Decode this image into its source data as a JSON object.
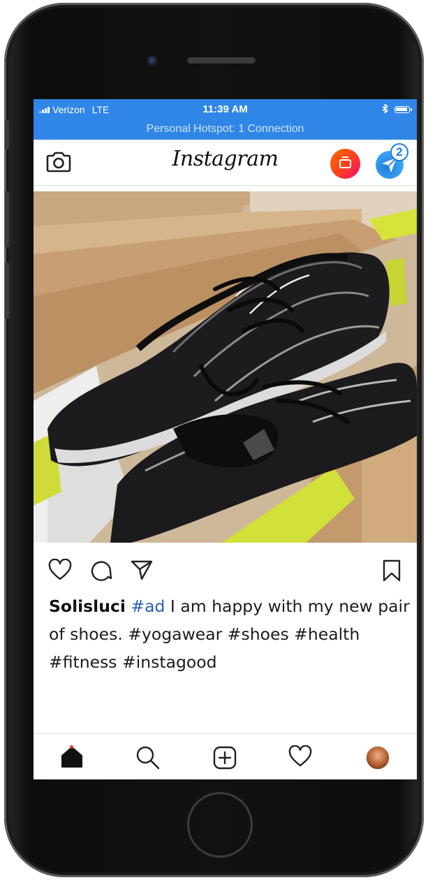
{
  "status_bar": {
    "carrier": "Verizon",
    "network": "LTE",
    "time": "11:39 AM",
    "hotspot": "Personal Hotspot: 1 Connection",
    "icons": [
      "signal-icon",
      "bluetooth-icon",
      "battery-icon"
    ]
  },
  "header": {
    "logo": "Instagram",
    "direct_badge": "2",
    "icons": [
      "camera-icon",
      "igtv-icon",
      "direct-message-icon"
    ]
  },
  "post": {
    "image_subject": "black running shoes in cardboard box",
    "actions": [
      "heart-icon",
      "comment-icon",
      "share-icon",
      "bookmark-icon"
    ],
    "caption": {
      "username": "Solisluci",
      "hashtag_ad": "#ad",
      "text": " I am happy with my new pair of shoes.  #yogawear #shoes #health #fitness #instagood"
    }
  },
  "tab_bar": {
    "items": [
      "home-icon",
      "search-icon",
      "add-post-icon",
      "activity-heart-icon",
      "profile-avatar"
    ]
  },
  "colors": {
    "status_bar": "#2f86e6",
    "hashtag_ad": "#2c5fb3",
    "notification_dot": "#e8353d"
  }
}
